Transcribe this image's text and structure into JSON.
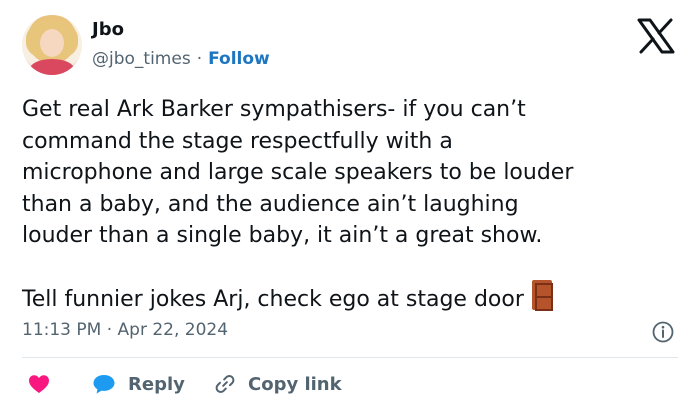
{
  "author": {
    "name": "Jbo",
    "handle": "@jbo_times",
    "separator": "·",
    "follow_label": "Follow"
  },
  "tweet": {
    "paragraph1": "Get real Ark Barker sympathisers- if you can’t\ncommand the stage respectfully with a\nmicrophone and large scale speakers to be louder\nthan a baby, and the audience ain’t laughing\nlouder than a single baby, it ain’t a great show.",
    "paragraph2": "Tell funnier jokes Arj, check ego at stage door",
    "emoji": "door",
    "timestamp": "11:13 PM · Apr 22, 2024"
  },
  "actions": {
    "reply_label": "Reply",
    "copy_label": "Copy link"
  },
  "icons": {
    "logo": "x-logo-icon",
    "info": "info-icon",
    "heart": "heart-icon",
    "reply": "reply-bubble-icon",
    "copy": "link-icon"
  },
  "colors": {
    "text": "#0f1419",
    "muted": "#536471",
    "follow": "#1d76c2",
    "heart": "#f91880",
    "reply": "#1d9bf0",
    "divider": "#e1e8ed"
  }
}
